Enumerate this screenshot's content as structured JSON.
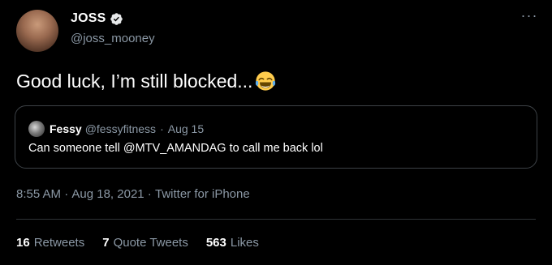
{
  "author": {
    "display_name": "JOSS",
    "handle": "@joss_mooney",
    "verified": true,
    "more_icon": "more-dots-icon"
  },
  "tweet": {
    "text": "Good luck, I’m still blocked...",
    "emoji": "face-with-tears-of-joy-emoji"
  },
  "quoted": {
    "display_name": "Fessy",
    "handle": "@fessyfitness",
    "separator": "·",
    "date": "Aug 15",
    "text": "Can someone tell @MTV_AMANDAG to call me back lol"
  },
  "meta": {
    "time": "8:55 AM",
    "sep1": " · ",
    "date": "Aug 18, 2021",
    "sep2": " · ",
    "source": "Twitter for iPhone"
  },
  "stats": {
    "retweets_count": "16",
    "retweets_label": "Retweets",
    "quotes_count": "7",
    "quotes_label": "Quote Tweets",
    "likes_count": "563",
    "likes_label": "Likes"
  },
  "colors": {
    "background": "#000000",
    "text_primary": "#ffffff",
    "text_secondary": "#8b98a5",
    "verified_badge": "#e7e9ea",
    "border": "#3d4247"
  }
}
